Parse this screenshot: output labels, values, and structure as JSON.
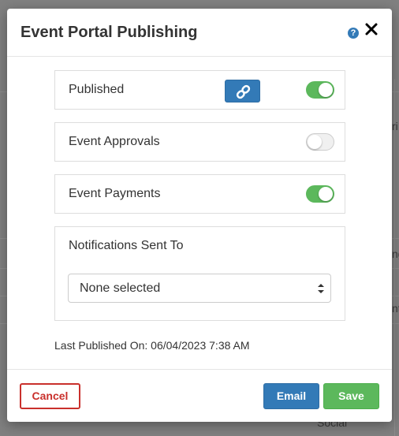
{
  "modal": {
    "title": "Event Portal Publishing",
    "help_icon": "?",
    "close_icon": "✕"
  },
  "settings": {
    "published": {
      "label": "Published",
      "enabled": true,
      "link_icon": "link-icon"
    },
    "approvals": {
      "label": "Event Approvals",
      "enabled": false
    },
    "payments": {
      "label": "Event Payments",
      "enabled": true
    },
    "notifications": {
      "label": "Notifications Sent To",
      "selected": "None selected"
    }
  },
  "last_published": "Last Published On: 06/04/2023 7:38 AM",
  "footer": {
    "cancel_label": "Cancel",
    "email_label": "Email",
    "save_label": "Save"
  },
  "background": {
    "fragments": [
      "ri",
      "ng",
      "nt",
      "Social"
    ]
  },
  "colors": {
    "primary": "#337ab7",
    "success": "#5cb85c",
    "danger": "#c9302c"
  }
}
